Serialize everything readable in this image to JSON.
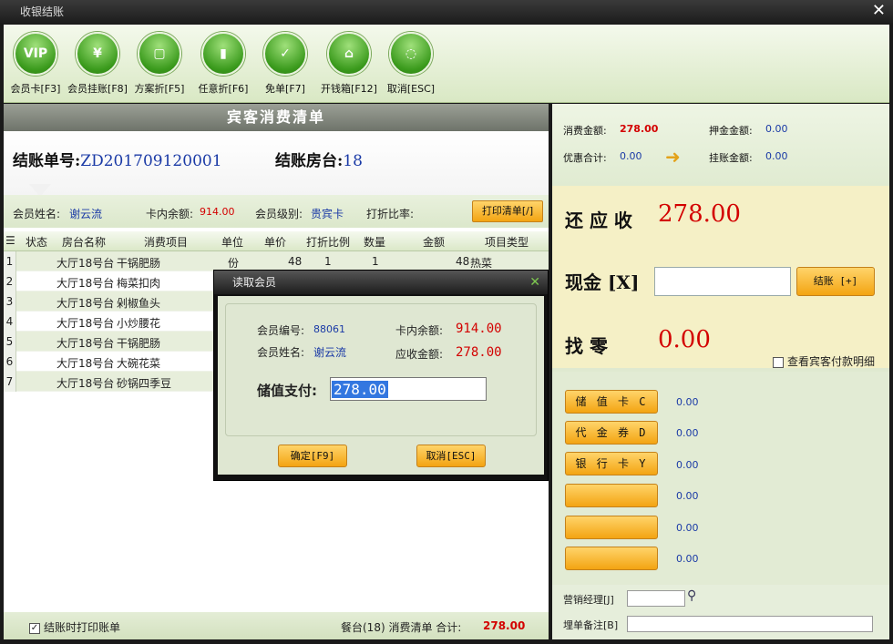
{
  "window": {
    "title": "收银结账",
    "close": "✕"
  },
  "toolbar": [
    {
      "label": "会员卡[F3]",
      "icon": "VIP"
    },
    {
      "label": "会员挂账[F8]",
      "icon": "¥"
    },
    {
      "label": "方案折[F5]",
      "icon": "▢"
    },
    {
      "label": "任意折[F6]",
      "icon": "▮"
    },
    {
      "label": "免单[F7]",
      "icon": "✓"
    },
    {
      "label": "开钱箱[F12]",
      "icon": "⌂"
    },
    {
      "label": "取消[ESC]",
      "icon": "◌"
    }
  ],
  "left": {
    "title": "宾客消费清单",
    "bill_no_label": "结账单号:",
    "bill_no": "ZD201709120001",
    "room_label": "结账房台:",
    "room": "18",
    "member_name_label": "会员姓名:",
    "member_name": "谢云流",
    "balance_label": "卡内余额:",
    "balance": "914.00",
    "level_label": "会员级别:",
    "level": "贵宾卡",
    "discount_label": "打折比率:",
    "print_btn": "打印清单[/]",
    "columns": [
      "状态",
      "房台名称",
      "消费项目",
      "单位",
      "单价",
      "打折比例",
      "数量",
      "金额",
      "项目类型"
    ],
    "rows": [
      {
        "n": "1",
        "room": "大厅18号台",
        "item": "干锅肥肠",
        "unit": "份",
        "price": "48",
        "disc": "1",
        "qty": "1",
        "amount": "48",
        "type": "热菜"
      },
      {
        "n": "2",
        "room": "大厅18号台",
        "item": "梅菜扣肉"
      },
      {
        "n": "3",
        "room": "大厅18号台",
        "item": "剁椒鱼头"
      },
      {
        "n": "4",
        "room": "大厅18号台",
        "item": "小炒腰花"
      },
      {
        "n": "5",
        "room": "大厅18号台",
        "item": "干锅肥肠"
      },
      {
        "n": "6",
        "room": "大厅18号台",
        "item": "大碗花菜"
      },
      {
        "n": "7",
        "room": "大厅18号台",
        "item": "砂锅四季豆"
      }
    ],
    "footer": {
      "print_on_checkout": "结账时打印账单",
      "table_info": "餐台(18) 消费清单 合计:",
      "total": "278.00"
    }
  },
  "right": {
    "consume_label": "消费金额:",
    "consume": "278.00",
    "deposit_label": "押金金额:",
    "deposit": "0.00",
    "discount_label": "优惠合计:",
    "discount": "0.00",
    "credit_label": "挂账金额:",
    "credit": "0.00",
    "due_label": "还 应 收",
    "due": "278.00",
    "cash_label": "现金 [X]",
    "checkout_btn": "结账 [+]",
    "change_label": "找  零",
    "change": "0.00",
    "view_detail": "查看宾客付款明细",
    "payments": [
      {
        "label": "储 值 卡 C",
        "value": "0.00"
      },
      {
        "label": "代 金 券 D",
        "value": "0.00"
      },
      {
        "label": "银 行 卡 Y",
        "value": "0.00"
      },
      {
        "label": "",
        "value": "0.00"
      },
      {
        "label": "",
        "value": "0.00"
      },
      {
        "label": "",
        "value": "0.00"
      }
    ],
    "manager_label": "营销经理[J]",
    "remark_label": "埋单备注[B]"
  },
  "dialog": {
    "title": "读取会员",
    "close": "✕",
    "member_no_label": "会员编号:",
    "member_no": "88061",
    "member_name_label": "会员姓名:",
    "member_name": "谢云流",
    "balance_label": "卡内余额:",
    "balance": "914.00",
    "due_label": "应收金额:",
    "due": "278.00",
    "stored_pay_label": "储值支付:",
    "stored_pay": "278.00",
    "ok": "确定[F9]",
    "cancel": "取消[ESC]"
  }
}
